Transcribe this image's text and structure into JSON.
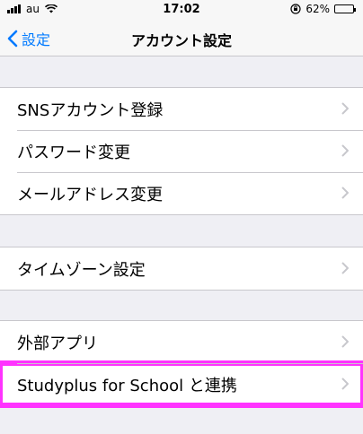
{
  "status_bar": {
    "carrier": "au",
    "time": "17:02",
    "battery_text": "62%",
    "battery_level": 0.62
  },
  "nav": {
    "back_label": "設定",
    "title": "アカウント設定"
  },
  "groups": [
    {
      "items": [
        {
          "label": "SNSアカウント登録"
        },
        {
          "label": "パスワード変更"
        },
        {
          "label": "メールアドレス変更"
        }
      ]
    },
    {
      "items": [
        {
          "label": "タイムゾーン設定"
        }
      ]
    },
    {
      "items": [
        {
          "label": "外部アプリ"
        },
        {
          "label": "Studyplus for School と連携",
          "highlighted": true
        }
      ]
    }
  ],
  "colors": {
    "accent": "#007aff",
    "highlight": "#ff33ff",
    "background": "#efeff4",
    "chevron": "#c7c7cc"
  },
  "icons": [
    "signal-icon",
    "wifi-icon",
    "orientation-lock-icon",
    "battery-icon",
    "back-chevron-icon",
    "chevron-right-icon"
  ]
}
